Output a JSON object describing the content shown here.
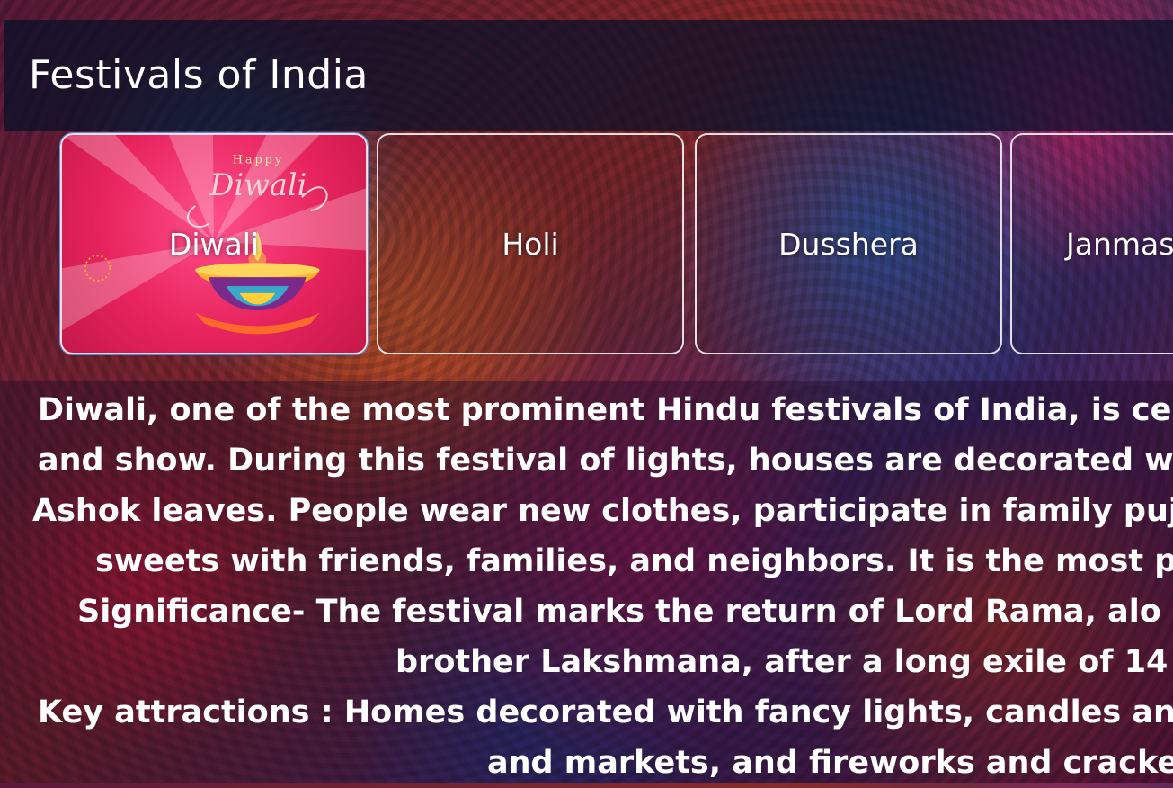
{
  "page": {
    "title": "Festivals of India"
  },
  "festivals": [
    {
      "label": "Diwali",
      "active": true,
      "image_text": {
        "small": "Happy",
        "script": "Diwali"
      }
    },
    {
      "label": "Holi",
      "active": false
    },
    {
      "label": "Dusshera",
      "active": false
    },
    {
      "label": "Janmas",
      "active": false
    }
  ],
  "description": {
    "lines": [
      "Diwali, one of the most prominent Hindu festivals of India, is ce",
      "and show. During this festival of lights, houses are decorated w",
      "Ashok leaves. People wear new clothes, participate in family puja",
      "sweets with friends, families, and neighbors. It is the most p",
      "Significance- The festival marks the return of Lord Rama, alo",
      "brother Lakshmana, after a long exile of 14",
      "Key attractions : Homes decorated with fancy lights, candles an",
      "and markets, and fireworks and cracke"
    ]
  },
  "colors": {
    "text": "#ffffff",
    "header_bg": "#050f28",
    "active_card": "#e8245e"
  }
}
